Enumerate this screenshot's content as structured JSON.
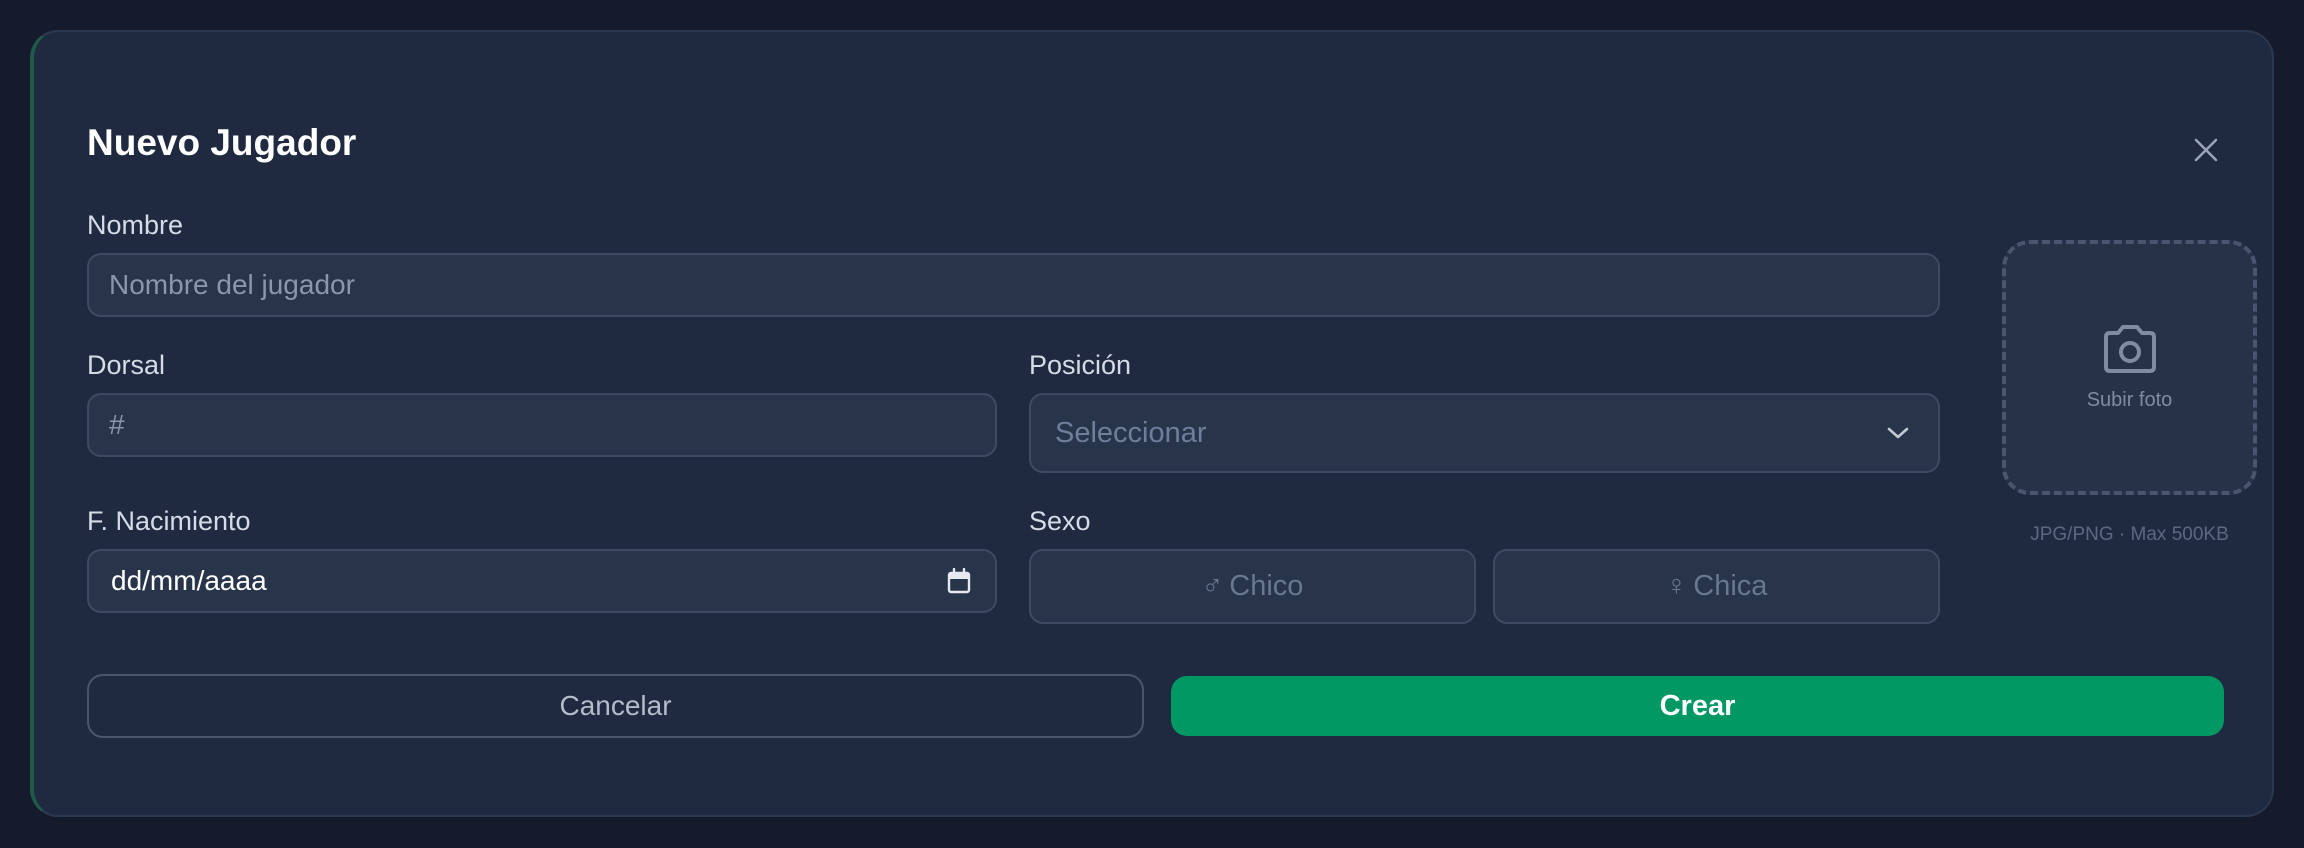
{
  "modal": {
    "title": "Nuevo Jugador"
  },
  "form": {
    "name": {
      "label": "Nombre",
      "placeholder": "Nombre del jugador"
    },
    "dorsal": {
      "label": "Dorsal",
      "placeholder": "#"
    },
    "position": {
      "label": "Posición",
      "selected": "Seleccionar"
    },
    "birthdate": {
      "label": "F. Nacimiento",
      "value": "dd/mm/aaaa"
    },
    "sex": {
      "label": "Sexo",
      "options": [
        {
          "symbol": "♂",
          "label": "Chico"
        },
        {
          "symbol": "♀",
          "label": "Chica"
        }
      ]
    }
  },
  "photo": {
    "label": "Subir foto",
    "hint": "JPG/PNG · Max 500KB",
    "icon": "camera-icon"
  },
  "actions": {
    "cancel_label": "Cancelar",
    "create_label": "Crear"
  },
  "colors": {
    "accent": "#019863",
    "panel": "#1f2a40",
    "background": "#151b2d"
  }
}
